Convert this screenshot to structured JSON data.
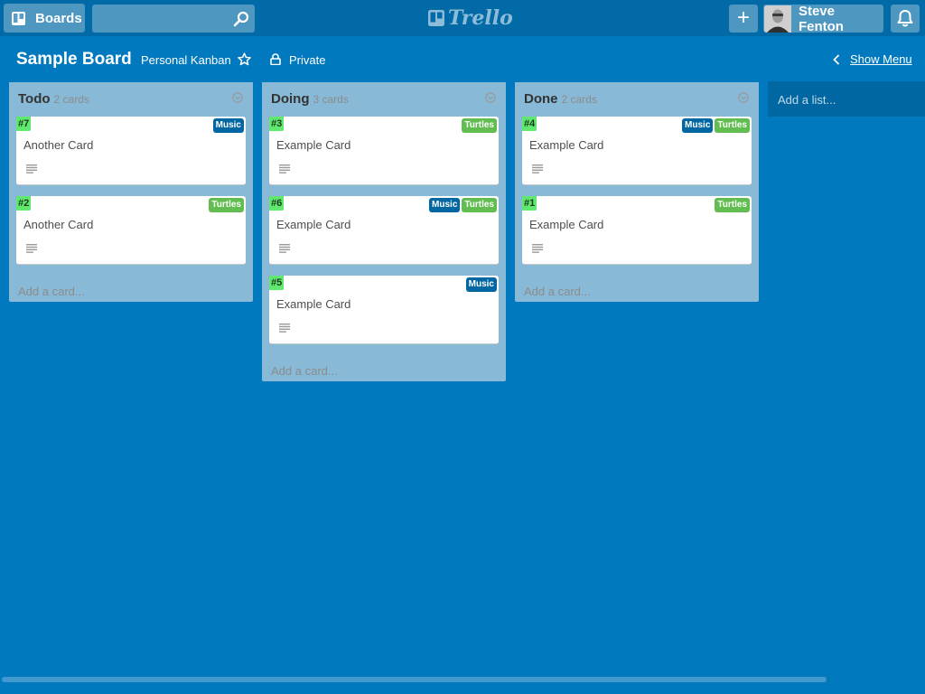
{
  "header": {
    "boards_label": "Boards",
    "search_value": "",
    "logo_text": "Trello",
    "add_label": "+",
    "user_name": "Steve Fenton"
  },
  "board": {
    "title": "Sample Board",
    "team": "Personal Kanban",
    "privacy": "Private",
    "show_menu": "Show Menu"
  },
  "colors": {
    "background": "#0079bf",
    "header": "#026aa7",
    "label_music": "#0067a3",
    "label_turtles": "#61bd4f",
    "card_number": "#61e86f"
  },
  "lists": [
    {
      "title": "Todo",
      "count": "2 cards",
      "add_card": "Add a card...",
      "cards": [
        {
          "number": "#7",
          "title": "Another Card",
          "labels": [
            {
              "text": "Music",
              "color": "#0067a3"
            }
          ]
        },
        {
          "number": "#2",
          "title": "Another Card",
          "labels": [
            {
              "text": "Turtles",
              "color": "#61bd4f"
            }
          ]
        }
      ]
    },
    {
      "title": "Doing",
      "count": "3 cards",
      "add_card": "Add a card...",
      "cards": [
        {
          "number": "#3",
          "title": "Example Card",
          "labels": [
            {
              "text": "Turtles",
              "color": "#61bd4f"
            }
          ]
        },
        {
          "number": "#6",
          "title": "Example Card",
          "labels": [
            {
              "text": "Music",
              "color": "#0067a3"
            },
            {
              "text": "Turtles",
              "color": "#61bd4f"
            }
          ]
        },
        {
          "number": "#5",
          "title": "Example Card",
          "labels": [
            {
              "text": "Music",
              "color": "#0067a3"
            }
          ]
        }
      ]
    },
    {
      "title": "Done",
      "count": "2 cards",
      "add_card": "Add a card...",
      "cards": [
        {
          "number": "#4",
          "title": "Example Card",
          "labels": [
            {
              "text": "Music",
              "color": "#0067a3"
            },
            {
              "text": "Turtles",
              "color": "#61bd4f"
            }
          ]
        },
        {
          "number": "#1",
          "title": "Example Card",
          "labels": [
            {
              "text": "Turtles",
              "color": "#61bd4f"
            }
          ]
        }
      ]
    }
  ],
  "add_list": "Add a list...",
  "icons": {
    "boards": "board-icon",
    "search": "search-icon",
    "notifications": "bell-icon",
    "star": "star-icon",
    "privacy": "lock-icon",
    "back": "chevron-left-icon",
    "list_menu": "chevron-down-circle-icon",
    "description": "description-icon"
  }
}
